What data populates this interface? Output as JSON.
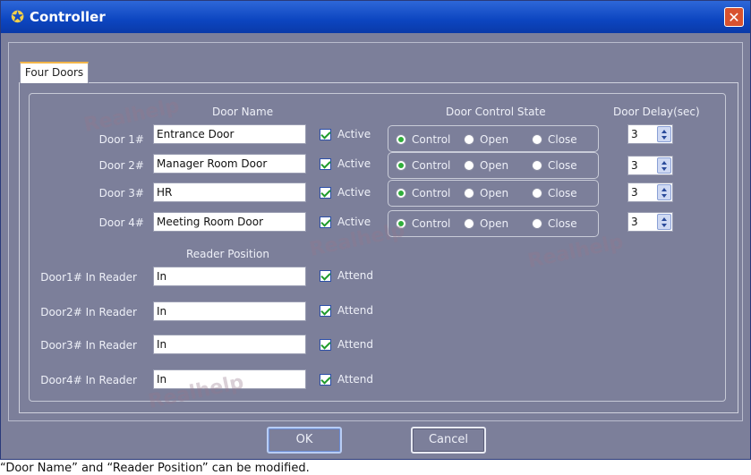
{
  "window": {
    "title": "Controller"
  },
  "tabs": [
    {
      "label": "Four Doors"
    }
  ],
  "headers": {
    "door_name": "Door Name",
    "door_control_state": "Door Control State",
    "door_delay": "Door Delay(sec)",
    "reader_position": "Reader Position"
  },
  "doors": [
    {
      "label": "Door 1#",
      "name": "Entrance Door",
      "active_label": "Active",
      "active": true,
      "control": "Control",
      "open": "Open",
      "close": "Close",
      "selected": "Control",
      "delay": "3"
    },
    {
      "label": "Door 2#",
      "name": "Manager Room Door",
      "active_label": "Active",
      "active": true,
      "control": "Control",
      "open": "Open",
      "close": "Close",
      "selected": "Control",
      "delay": "3"
    },
    {
      "label": "Door 3#",
      "name": "HR",
      "active_label": "Active",
      "active": true,
      "control": "Control",
      "open": "Open",
      "close": "Close",
      "selected": "Control",
      "delay": "3"
    },
    {
      "label": "Door 4#",
      "name": "Meeting Room Door",
      "active_label": "Active",
      "active": true,
      "control": "Control",
      "open": "Open",
      "close": "Close",
      "selected": "Control",
      "delay": "3"
    }
  ],
  "readers": [
    {
      "label": "Door1# In Reader",
      "position": "In",
      "attend_label": "Attend",
      "attend": true
    },
    {
      "label": "Door2# In Reader",
      "position": "In",
      "attend_label": "Attend",
      "attend": true
    },
    {
      "label": "Door3# In Reader",
      "position": "In",
      "attend_label": "Attend",
      "attend": true
    },
    {
      "label": "Door4# In Reader",
      "position": "In",
      "attend_label": "Attend",
      "attend": true
    }
  ],
  "buttons": {
    "ok": "OK",
    "cancel": "Cancel"
  },
  "watermark": "Realhelp",
  "caption": "“Door Name” and “Reader Position” can be modified."
}
